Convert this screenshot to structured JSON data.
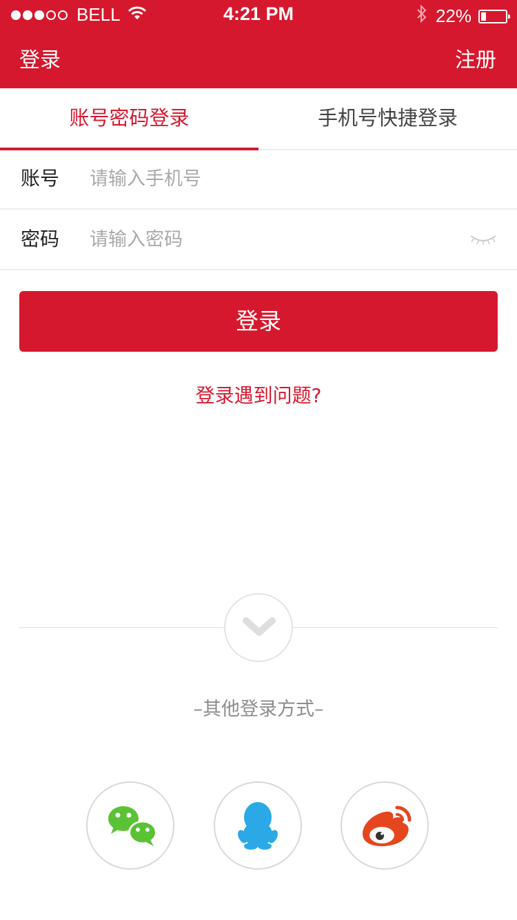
{
  "status_bar": {
    "carrier": "BELL",
    "time": "4:21 PM",
    "battery": "22%",
    "battery_level": 0.22,
    "signal_dots": {
      "filled": 3,
      "total": 5
    },
    "icons": [
      "signal-dots-icon",
      "wifi-icon",
      "bluetooth-icon",
      "battery-icon"
    ]
  },
  "header": {
    "title": "登录",
    "register": "注册"
  },
  "tabs": [
    {
      "label": "账号密码登录",
      "active": true
    },
    {
      "label": "手机号快捷登录",
      "active": false
    }
  ],
  "form": {
    "account": {
      "label": "账号",
      "placeholder": "请输入手机号",
      "value": ""
    },
    "password": {
      "label": "密码",
      "placeholder": "请输入密码",
      "value": ""
    },
    "password_toggle_icon": "eye-closed-icon"
  },
  "login_button": "登录",
  "help_link": "登录遇到问题?",
  "expand_icon": "chevron-down-icon",
  "other_login": "–其他登录方式–",
  "social": [
    {
      "name": "wechat",
      "icon": "wechat-icon"
    },
    {
      "name": "qq",
      "icon": "qq-icon"
    },
    {
      "name": "weibo",
      "icon": "weibo-icon"
    }
  ],
  "colors": {
    "brand_red": "#d6182e",
    "wechat_green": "#5ac234",
    "qq_blue": "#2aa9e6",
    "weibo_red": "#e6461e"
  }
}
